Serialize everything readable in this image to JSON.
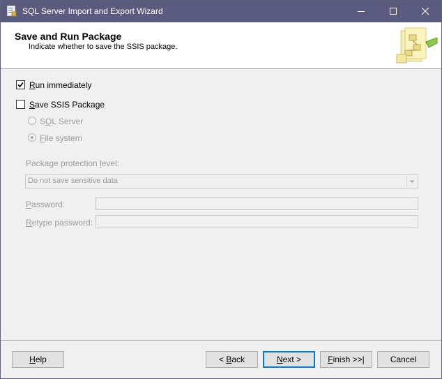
{
  "window": {
    "title": "SQL Server Import and Export Wizard"
  },
  "header": {
    "title": "Save and Run Package",
    "subtitle": "Indicate whether to save the SSIS package."
  },
  "options": {
    "run_immediately": {
      "accel": "R",
      "rest": "un immediately",
      "checked": true
    },
    "save_ssis": {
      "pre": "",
      "accel": "S",
      "rest": "ave SSIS Package",
      "checked": false
    },
    "sql_server": {
      "pre": "S",
      "accel": "Q",
      "rest": "L Server",
      "selected": false
    },
    "file_system": {
      "accel": "F",
      "rest": "ile system",
      "selected": true
    }
  },
  "protection": {
    "label_pre": "Package protection ",
    "label_accel": "l",
    "label_rest": "evel:",
    "selected": "Do not save sensitive data"
  },
  "password": {
    "accel": "P",
    "rest": "assword:",
    "value": ""
  },
  "retype": {
    "accel": "R",
    "rest": "etype password:",
    "value": ""
  },
  "buttons": {
    "help": {
      "accel": "H",
      "rest": "elp"
    },
    "back": {
      "pre": "< ",
      "accel": "B",
      "rest": "ack"
    },
    "next": {
      "accel": "N",
      "rest": "ext >"
    },
    "finish": {
      "accel": "F",
      "rest": "inish >>|"
    },
    "cancel": "Cancel"
  }
}
